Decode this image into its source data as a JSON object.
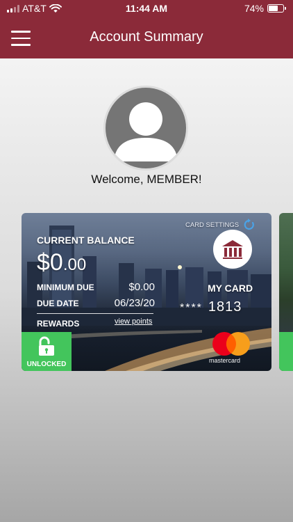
{
  "status_bar": {
    "carrier": "AT&T",
    "time": "11:44 AM",
    "battery": "74%",
    "battery_level": 0.74
  },
  "header": {
    "title": "Account Summary"
  },
  "welcome": "Welcome, MEMBER!",
  "card": {
    "settings_label": "CARD SETTINGS",
    "current_balance_label": "CURRENT BALANCE",
    "balance_whole": "$0",
    "balance_cents": ".00",
    "minimum_due_label": "MINIMUM DUE",
    "minimum_due_value": "$0.00",
    "due_date_label": "DUE DATE",
    "due_date_value": "06/23/20",
    "rewards_label": "REWARDS",
    "view_points_label": "view points",
    "my_card_label": "MY CARD",
    "card_mask": "****",
    "card_last4": "1813",
    "lock_status": "UNLOCKED",
    "network": "mastercard"
  },
  "colors": {
    "brand": "#8b2a39",
    "unlock_green": "#43c55c",
    "mc_red": "#eb001b",
    "mc_orange": "#f79e1b"
  }
}
